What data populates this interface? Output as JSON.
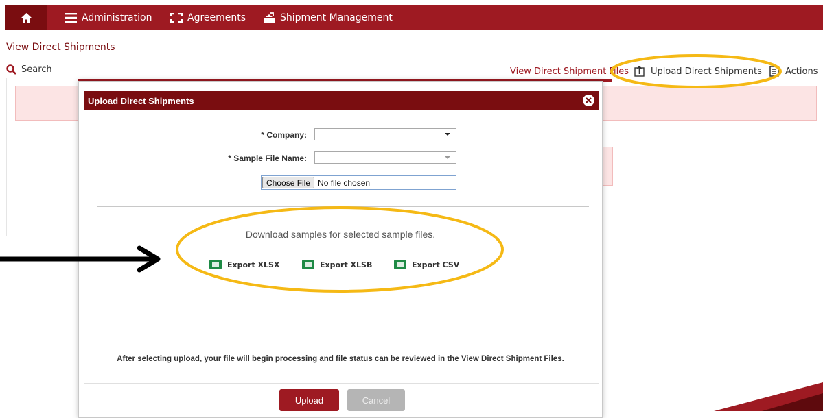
{
  "nav": {
    "home_icon": "home-icon",
    "items": [
      {
        "label": "Administration",
        "icon": "menu-icon"
      },
      {
        "label": "Agreements",
        "icon": "brackets-icon"
      },
      {
        "label": "Shipment Management",
        "icon": "shipment-icon"
      }
    ]
  },
  "page": {
    "title": "View Direct Shipments",
    "search_label": "Search",
    "links": {
      "view_files": "View Direct Shipment Files",
      "upload": "Upload Direct Shipments",
      "actions": "Actions"
    }
  },
  "modal": {
    "title": "Upload Direct Shipments",
    "company_label": "* Company:",
    "company_value": "",
    "sample_label": "* Sample File Name:",
    "sample_value": "",
    "choose_file_label": "Choose File",
    "file_status": "No file chosen",
    "download_text": "Download samples for selected sample files.",
    "exports": [
      {
        "label": "Export XLSX",
        "icon": "excel-icon"
      },
      {
        "label": "Export XLSB",
        "icon": "excel-icon"
      },
      {
        "label": "Export CSV",
        "icon": "excel-icon"
      }
    ],
    "note": "After selecting upload, your file will begin processing and file status can be reviewed in the View Direct Shipment Files.",
    "upload_button": "Upload",
    "cancel_button": "Cancel"
  },
  "colors": {
    "brand": "#9e1a22",
    "brand_dark": "#7a0d10",
    "highlight": "#f5b915",
    "excel_green": "#1e8a45"
  }
}
